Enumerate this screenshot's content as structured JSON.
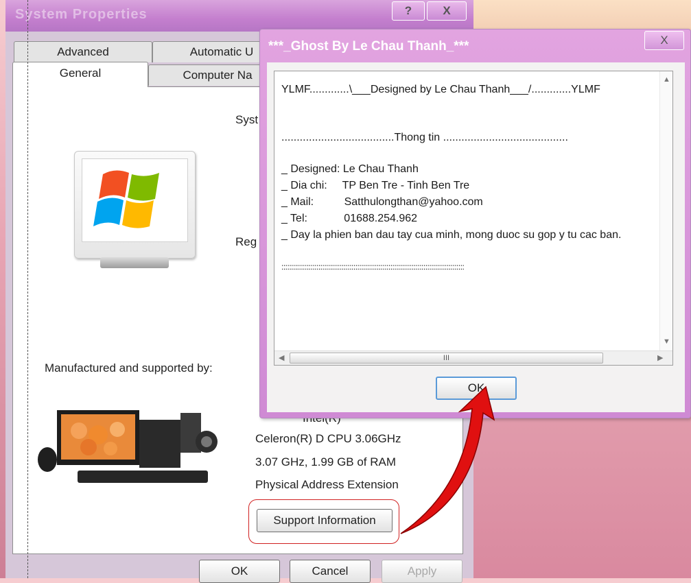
{
  "system_properties": {
    "title": "System Properties",
    "help_button": "?",
    "close_button": "X",
    "tabs_top": [
      "Advanced",
      "Automatic U"
    ],
    "tabs_bottom": [
      "General",
      "Computer Na"
    ],
    "partial_labels": {
      "system": "Syst",
      "registered": "Reg"
    },
    "manufactured_label": "Manufactured and supported by:",
    "cpu_vendor": "Intel(R)",
    "cpu_line1": "Celeron(R) D CPU 3.06GHz",
    "cpu_line2": "3.07 GHz, 1.99 GB of RAM",
    "cpu_line3": "Physical Address Extension",
    "support_button": "Support Information",
    "ok_button": "OK",
    "cancel_button": "Cancel",
    "apply_button": "Apply"
  },
  "ghost_dialog": {
    "title": "***_Ghost By Le Chau Thanh_***",
    "close_button": "X",
    "lines": [
      "YLMF.............\\___Designed by Le Chau Thanh___/.............YLMF",
      "",
      ".....................................Thong tin .........................................",
      "",
      "_ Designed: Le Chau Thanh",
      "_ Dia chi:     TP Ben Tre - Tinh Ben Tre",
      "_ Mail:          Satthulongthan@yahoo.com",
      "_ Tel:            01688.254.962",
      "_ Day la phien ban dau tay cua minh, mong duoc su gop y tu cac ban.",
      "",
      "::::::::::::::::::::::::::::::::::::::::::::::::::::::::::::::::::::::::::::::::::::::::::::::"
    ],
    "scroll_thumb_glyph": "III",
    "ok_button": "OK"
  },
  "colors": {
    "title_purple": "#c47fce",
    "highlight_red": "#d02020",
    "arrow_red": "#e01010"
  }
}
